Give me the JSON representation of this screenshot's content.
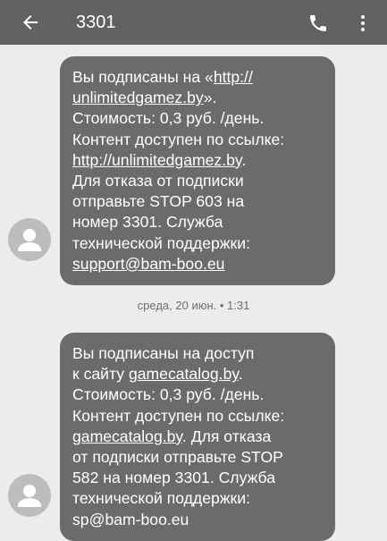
{
  "header": {
    "title": "3301",
    "back_icon": "arrow-left-icon",
    "call_icon": "phone-icon",
    "more_icon": "more-vert-icon"
  },
  "colors": {
    "appbar": "#616161",
    "background": "#ececec",
    "bubble": "#6b6b6b",
    "avatar": "#bdbdbd"
  },
  "messages": [
    {
      "lines": [
        [
          "Вы подписаны на «",
          "http://",
          ""
        ],
        [
          "",
          "unlimitedgamez.by",
          "»."
        ],
        [
          "Стоимость: 0,3 руб. /день.",
          "",
          ""
        ],
        [
          "Контент доступен по ссылке:",
          "",
          ""
        ],
        [
          "",
          "http://unlimitedgamez.by",
          "."
        ],
        [
          "Для отказа от подписки",
          "",
          ""
        ],
        [
          "отправьте STOP 603 на",
          "",
          ""
        ],
        [
          "номер 3301. Служба",
          "",
          ""
        ],
        [
          "технической поддержки:",
          "",
          ""
        ],
        [
          "",
          "support@bam-boo.eu",
          ""
        ]
      ]
    },
    {
      "lines": [
        [
          "Вы подписаны на доступ",
          "",
          ""
        ],
        [
          "к сайту ",
          "gamecatalog.by",
          "."
        ],
        [
          "Стоимость: 0,3 руб. /день.",
          "",
          ""
        ],
        [
          "Контент доступен по ссылке:",
          "",
          ""
        ],
        [
          "",
          "gamecatalog.by",
          ". Для отказа"
        ],
        [
          "от подписки отправьте STOP",
          "",
          ""
        ],
        [
          "582 на номер 3301. Служба",
          "",
          ""
        ],
        [
          "технической поддержки:",
          "",
          ""
        ],
        [
          "sp@bam-boo.eu",
          "",
          ""
        ]
      ]
    }
  ],
  "timestamp": "среда, 20 июн. • 1:31"
}
